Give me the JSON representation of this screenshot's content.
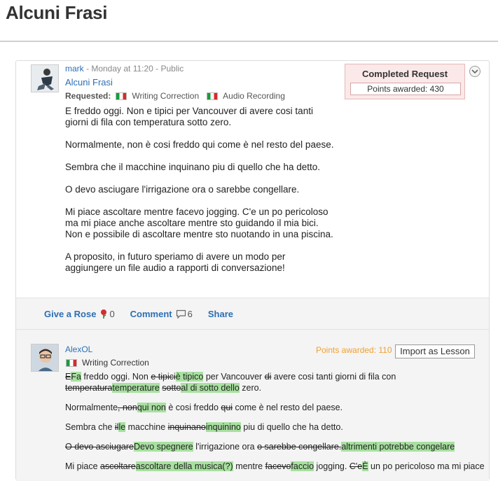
{
  "page": {
    "title": "Alcuni Frasi"
  },
  "post": {
    "author": "mark",
    "meta_rest": " - Monday at 11:20 - Public",
    "title": "Alcuni Frasi",
    "requested_label": "Requested:",
    "requested_items": [
      "Writing Correction",
      "Audio Recording"
    ],
    "paragraphs": [
      [
        "E freddo oggi. Non e tipici per Vancouver di avere cosi tanti",
        "giorni di fila con temperatura sotto zero."
      ],
      [
        "Normalmente, non è cosi freddo qui come è nel resto del paese."
      ],
      [
        "Sembra che il macchine inquinano piu di quello che ha detto."
      ],
      [
        "O devo asciugare l'irrigazione ora o sarebbe congellare."
      ],
      [
        "Mi piace ascoltare mentre facevo jogging. C'e un po pericoloso",
        "ma mi piace anche ascoltare mentre sto guidando il mia bici.",
        "Non e possibile di ascoltare mentre sto nuotando in una piscina."
      ],
      [
        "A proposito, in futuro speriamo di avere un modo per",
        "aggiungere un file audio a rapporti di conversazione!"
      ]
    ],
    "status_title": "Completed Request",
    "points_awarded": "Points awarded: 430"
  },
  "actions": {
    "rose_label": "Give a Rose",
    "rose_count": "0",
    "comment_label": "Comment",
    "comment_count": "6",
    "share_label": "Share"
  },
  "answer": {
    "author": "AlexOL",
    "points": "Points awarded: 110",
    "import_label": "Import as Lesson",
    "request_type": "Writing Correction",
    "lines": [
      [
        [
          [
            "del",
            "E"
          ],
          [
            "ins",
            "Fa"
          ],
          [
            "n",
            " freddo oggi. Non "
          ],
          [
            "del",
            "e tipici"
          ],
          [
            "ins",
            "è tipico"
          ],
          [
            "n",
            " per Vancouver "
          ],
          [
            "del",
            "di"
          ],
          [
            "n",
            " avere cosi tanti giorni di fila con"
          ]
        ],
        [
          [
            "del",
            "temperatura"
          ],
          [
            "ins",
            "temperature"
          ],
          [
            "n",
            " "
          ],
          [
            "del",
            "sotto"
          ],
          [
            "ins",
            "al di sotto dello"
          ],
          [
            "n",
            " zero."
          ]
        ]
      ],
      [
        [
          [
            "n",
            "Normalmente"
          ],
          [
            "del",
            ", non"
          ],
          [
            "ins",
            "qui non"
          ],
          [
            "n",
            " è cosi freddo "
          ],
          [
            "del",
            "qui"
          ],
          [
            "n",
            " come è nel resto del paese."
          ]
        ]
      ],
      [
        [
          [
            "n",
            "Sembra che "
          ],
          [
            "del",
            "il"
          ],
          [
            "ins",
            "le"
          ],
          [
            "n",
            " macchine "
          ],
          [
            "del",
            "inquinano"
          ],
          [
            "ins",
            "inquinino"
          ],
          [
            "n",
            " piu di quello che ha detto."
          ]
        ]
      ],
      [
        [
          [
            "del",
            "O devo asciugare"
          ],
          [
            "ins",
            "Devo spegnere"
          ],
          [
            "n",
            " l'irrigazione ora "
          ],
          [
            "del",
            "o sarebbe congellare."
          ],
          [
            "ins",
            "altrimenti potrebbe congelare"
          ]
        ]
      ],
      [
        [
          [
            "n",
            "Mi piace "
          ],
          [
            "del",
            "ascoltare"
          ],
          [
            "ins",
            "ascoltare della musica(?)"
          ],
          [
            "n",
            " mentre "
          ],
          [
            "del",
            "facevo"
          ],
          [
            "ins",
            "faccio"
          ],
          [
            "n",
            " jogging. "
          ],
          [
            "del",
            "C'e"
          ],
          [
            "ins",
            "È"
          ],
          [
            "n",
            " un po pericoloso ma mi piace"
          ]
        ]
      ]
    ]
  },
  "colors": {
    "link": "#2c6fb5",
    "insert_bg": "#a8e0a0",
    "points_orange": "#f0a030",
    "status_bg": "#fbe9e9"
  }
}
